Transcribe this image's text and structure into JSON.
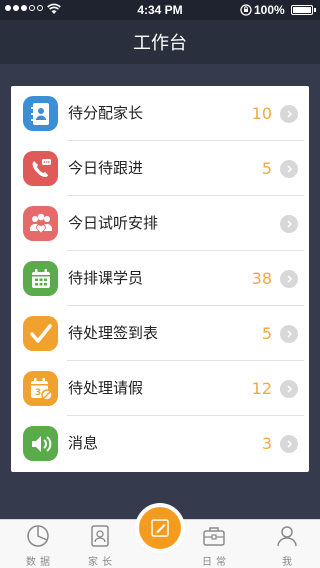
{
  "status_bar": {
    "time": "4:34 PM",
    "battery": "100%",
    "signal_icon": "signal-dots-icon",
    "wifi_icon": "wifi-icon",
    "lock_icon": "rotation-lock-icon"
  },
  "header": {
    "title": "工作台"
  },
  "colors": {
    "accent": "#f39c1f",
    "count": "#f0a944",
    "background": "#353a4d"
  },
  "items": [
    {
      "label": "待分配家长",
      "count": "10",
      "icon": "contacts-book-icon",
      "color": "#3b8fd6"
    },
    {
      "label": "今日待跟进",
      "count": "5",
      "icon": "phone-call-icon",
      "color": "#e05a5a"
    },
    {
      "label": "今日试听安排",
      "count": "",
      "icon": "people-heart-icon",
      "color": "#e56b6b"
    },
    {
      "label": "待排课学员",
      "count": "38",
      "icon": "calendar-grid-icon",
      "color": "#5aac4a"
    },
    {
      "label": "待处理签到表",
      "count": "5",
      "icon": "checkmark-icon",
      "color": "#f0a12e"
    },
    {
      "label": "待处理请假",
      "count": "12",
      "icon": "calendar-cancel-icon",
      "color": "#f0a12e"
    },
    {
      "label": "消息",
      "count": "3",
      "icon": "speaker-icon",
      "color": "#5aac4a"
    }
  ],
  "tabs": [
    {
      "label": "数据",
      "icon": "pie-chart-icon"
    },
    {
      "label": "家长",
      "icon": "contact-card-icon"
    },
    {
      "label": "",
      "icon": "edit-pen-icon"
    },
    {
      "label": "日常",
      "icon": "briefcase-icon"
    },
    {
      "label": "我",
      "icon": "person-icon"
    }
  ]
}
